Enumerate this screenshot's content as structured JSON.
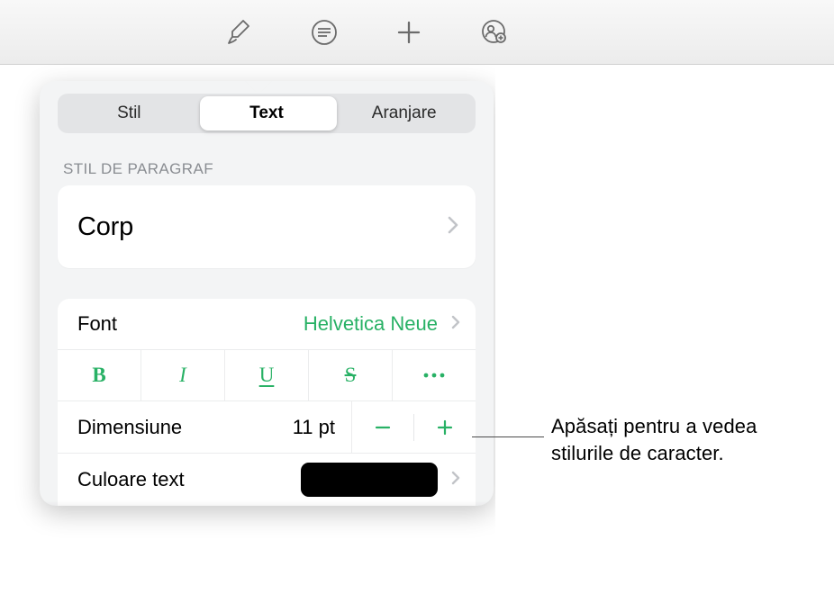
{
  "toolbar": {
    "icons": [
      "format-brush",
      "text-options",
      "add",
      "collaborate"
    ]
  },
  "tabs": {
    "stil": "Stil",
    "text": "Text",
    "aranjare": "Aranjare"
  },
  "paragraph": {
    "heading": "STIL DE PARAGRAF",
    "style_name": "Corp"
  },
  "font": {
    "label": "Font",
    "value": "Helvetica Neue"
  },
  "size": {
    "label": "Dimensiune",
    "value": "11 pt"
  },
  "color": {
    "label": "Culoare text",
    "value": "#000000"
  },
  "callout": {
    "line1": "Apăsați pentru a vedea",
    "line2": "stilurile de caracter."
  }
}
